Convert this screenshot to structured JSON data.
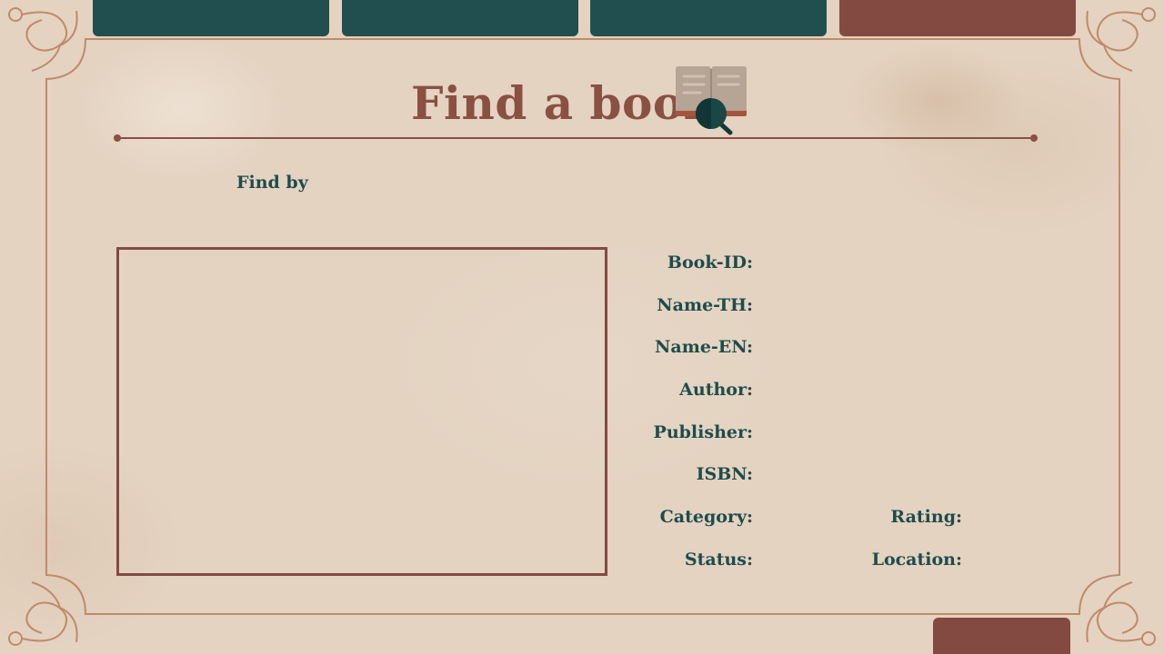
{
  "nav": {
    "tabs": [
      {
        "label": "",
        "color": "#214f4f"
      },
      {
        "label": "",
        "color": "#214f4f"
      },
      {
        "label": "",
        "color": "#214f4f"
      },
      {
        "label": "",
        "color": "#834a42",
        "active": true
      }
    ]
  },
  "header": {
    "title": "Find a book",
    "icon": "book-search-icon"
  },
  "search": {
    "find_by_label": "Find by"
  },
  "details": {
    "fields": [
      {
        "label": "Book-ID:"
      },
      {
        "label": "Name-TH:"
      },
      {
        "label": "Name-EN:"
      },
      {
        "label": "Author:"
      },
      {
        "label": "Publisher:"
      },
      {
        "label": "ISBN:"
      },
      {
        "label": "Category:"
      },
      {
        "label": "Rating:"
      },
      {
        "label": "Status:"
      },
      {
        "label": "Location:"
      }
    ]
  },
  "footer": {
    "action_label": ""
  },
  "colors": {
    "teal": "#214f4f",
    "brick": "#834a42",
    "title": "#8a5043",
    "frame": "#c08a6a",
    "paper": "#e4d3c1"
  }
}
